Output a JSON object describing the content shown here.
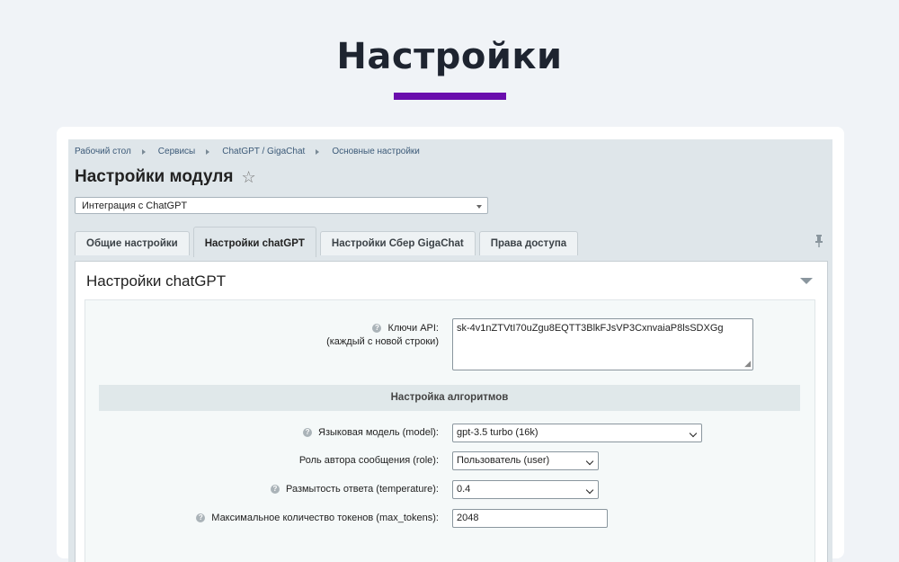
{
  "hero": {
    "title": "Настройки"
  },
  "breadcrumb": [
    "Рабочий стол",
    "Сервисы",
    "ChatGPT / GigaChat",
    "Основные настройки"
  ],
  "module": {
    "title": "Настройки модуля",
    "integration_select": "Интеграция с ChatGPT"
  },
  "tabs": [
    {
      "label": "Общие настройки",
      "active": false
    },
    {
      "label": "Настройки chatGPT",
      "active": true
    },
    {
      "label": "Настройки Сбер GigaChat",
      "active": false
    },
    {
      "label": "Права доступа",
      "active": false
    }
  ],
  "panel": {
    "title": "Настройки chatGPT",
    "api_keys": {
      "label_line1": "Ключи API:",
      "label_line2": "(каждый с новой строки)",
      "value": "sk-4v1nZTVtI70uZgu8EQTT3BlkFJsVP3CxnvaiaP8lsSDXGg"
    },
    "section_title": "Настройка алгоритмов",
    "fields": {
      "model": {
        "label": "Языковая модель (model):",
        "value": "gpt-3.5 turbo (16k)"
      },
      "role": {
        "label": "Роль автора сообщения (role):",
        "value": "Пользователь (user)"
      },
      "temperature": {
        "label": "Размытость ответа (temperature):",
        "value": "0.4"
      },
      "max_tokens": {
        "label": "Максимальное количество токенов (max_tokens):",
        "value": "2048"
      }
    }
  },
  "icons": {
    "help": "?",
    "star": "☆",
    "pin": "📌",
    "resize": "◢"
  },
  "colors": {
    "accent": "#6a0dad",
    "background": "#f0f3f7",
    "admin_bg": "#dfe6ea"
  }
}
